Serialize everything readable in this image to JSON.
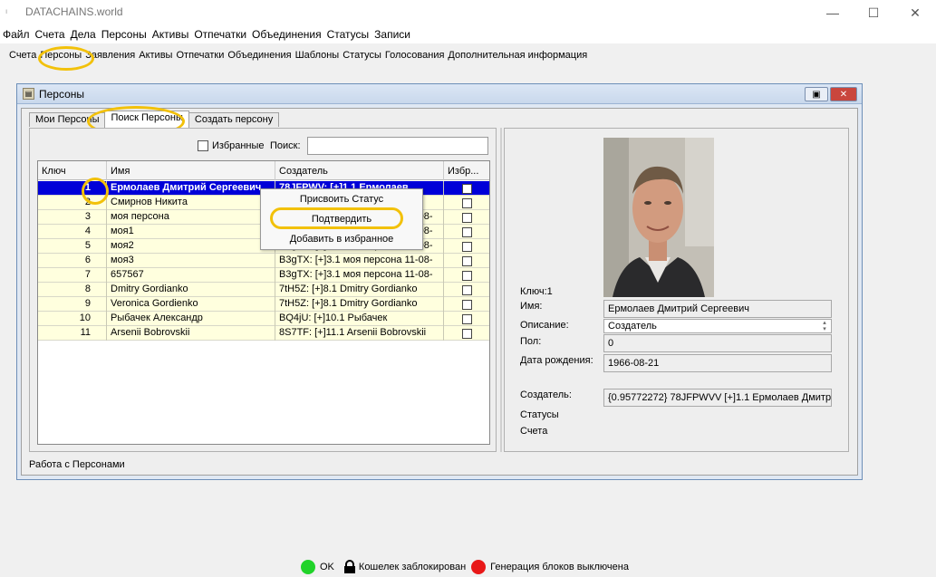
{
  "app": {
    "title": "DATACHAINS.world",
    "minimize": "—",
    "maximize": "☐",
    "close": "✕"
  },
  "menu": [
    "Файл",
    "Счета",
    "Дела",
    "Персоны",
    "Активы",
    "Отпечатки",
    "Объединения",
    "Статусы",
    "Записи"
  ],
  "toolbar": [
    "Счета",
    "Персоны",
    "Заявления",
    "Активы",
    "Отпечатки",
    "Объединения",
    "Шаблоны",
    "Статусы",
    "Голосования",
    "Дополнительная информация"
  ],
  "window": {
    "title": "Персоны",
    "status_text": "Работа с Персонами"
  },
  "tabs": [
    "Мои Персоны",
    "Поиск Персоны",
    "Создать персону"
  ],
  "search": {
    "favorites_label": "Избранные",
    "search_label": "Поиск:",
    "value": ""
  },
  "table": {
    "headers": [
      "Ключ",
      "Имя",
      "Создатель",
      "Избр..."
    ],
    "rows": [
      {
        "key": "1",
        "name": "Ермолаев Дмитрий Сергеевич",
        "creator": "78JFPWV: [+]1.1 Ермолаев"
      },
      {
        "key": "2",
        "name": "Смирнов Никита",
        "creator": "7tH5Z: [+]2.1 Смирнов Никита"
      },
      {
        "key": "3",
        "name": "моя персона",
        "creator": "B3gTX: [+]3.1 моя персона 11-08-"
      },
      {
        "key": "4",
        "name": "моя1",
        "creator": "B3gTX: [+]3.1 моя персона 11-08-"
      },
      {
        "key": "5",
        "name": "моя2",
        "creator": "B3gTX: [+]3.1 моя персона 11-08-"
      },
      {
        "key": "6",
        "name": "моя3",
        "creator": "B3gTX: [+]3.1 моя персона 11-08-"
      },
      {
        "key": "7",
        "name": "657567",
        "creator": "B3gTX: [+]3.1 моя персона 11-08-"
      },
      {
        "key": "8",
        "name": "Dmitry Gordianko",
        "creator": "7tH5Z: [+]8.1 Dmitry Gordianko"
      },
      {
        "key": "9",
        "name": "Veronica Gordienko",
        "creator": "7tH5Z: [+]8.1 Dmitry Gordianko"
      },
      {
        "key": "10",
        "name": "Рыбачек Александр",
        "creator": "BQ4jU: [+]10.1 Рыбачек"
      },
      {
        "key": "11",
        "name": "Arsenii Bobrovskii",
        "creator": "8S7TF: [+]11.1 Arsenii Bobrovskii"
      }
    ]
  },
  "context_menu": [
    "Присвоить Статус",
    "Подтвердить",
    "Добавить в избранное"
  ],
  "details": {
    "key_label": "Ключ:1",
    "name_label": "Имя:",
    "name_value": "Ермолаев Дмитрий Сергеевич",
    "desc_label": "Описание:",
    "desc_value": "Создатель",
    "gender_label": "Пол:",
    "gender_value": "0",
    "birth_label": "Дата рождения:",
    "birth_value": "1966-08-21",
    "creator_label": "Создатель:",
    "creator_value": "{0.95772272} 78JFPWVV [+]1.1 Ермолаев Дмитрий",
    "statuses_label": "Статусы",
    "accounts_label": "Счета"
  },
  "statusbar": {
    "ok": "OK",
    "ok_color": "#21d32a",
    "wallet": "Кошелек заблокирован",
    "generation": "Генерация блоков выключена",
    "generation_color": "#e81818"
  },
  "colors": {
    "selection": "#0000d8",
    "row_bg": "#ffffde",
    "highlight": "#f2c10a"
  }
}
